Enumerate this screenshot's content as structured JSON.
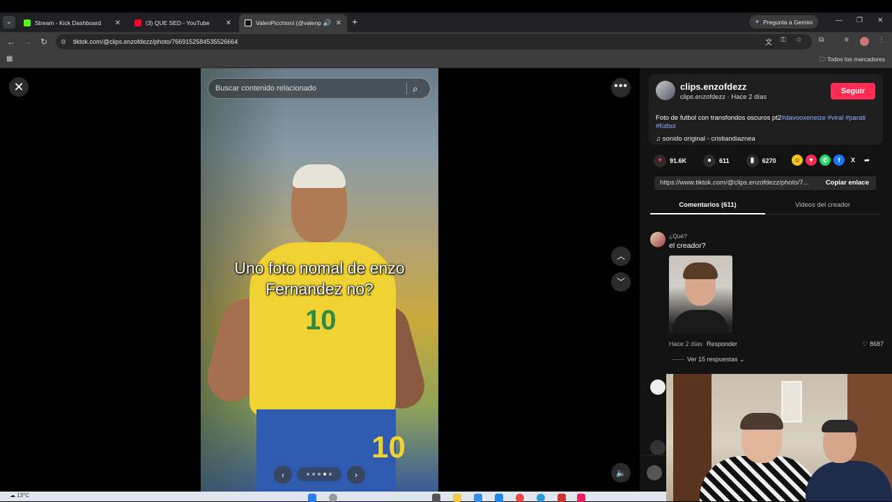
{
  "browser": {
    "tabs": [
      {
        "title": "Stream - Kick Dashboard",
        "favicon_color": "#53fc18",
        "active": false
      },
      {
        "title": "(3) QUE SED - YouTube",
        "favicon_color": "#ff0033",
        "active": false
      },
      {
        "title": "ValenPicchioni (@valenpicc",
        "favicon_color": "#ffffff",
        "active": true
      }
    ],
    "new_tab": "+",
    "gemini_label": "Pregunta a Gemini",
    "url": "tiktok.com/@clips.enzofdezz/photo/7669152584535526664",
    "bookmarks_all": "Todos los marcadores"
  },
  "viewer": {
    "search_placeholder": "Buscar contenido relacionado",
    "caption_line1": "Uno foto nomal de enzo",
    "caption_line2": "Fernandez no?",
    "jersey_number": "10",
    "carousel_dots": 5,
    "carousel_active": 3
  },
  "post": {
    "username": "clips.enzofdezz",
    "subline": "clips.enzofdezz · Hace 2 días",
    "follow_label": "Seguir",
    "description": "Foto de futbol con transfondos oscuros pt2",
    "hashtags": "#davooxeneize #viral #parati #fútbol",
    "music": "sonido original - cristiandiaznea",
    "likes": "91.6K",
    "comments": "611",
    "saves": "6270",
    "link": "https://www.tiktok.com/@clips.enzofdezz/photo/7...",
    "copy_label": "Copiar enlace"
  },
  "tabs": {
    "comments_tab": "Comentarios (611)",
    "creator_tab": "Videos del creador"
  },
  "comment": {
    "user": "¿Qué?",
    "text": "el creador?",
    "time": "Hace 2 días",
    "reply": "Responder",
    "likes": "8687",
    "more_replies": "Ver 15 respuestas ⌄"
  },
  "taskbar": {
    "weather": "13°C"
  },
  "colors": {
    "follow": "#fe2c55",
    "hashtag": "#8ab4ff"
  }
}
